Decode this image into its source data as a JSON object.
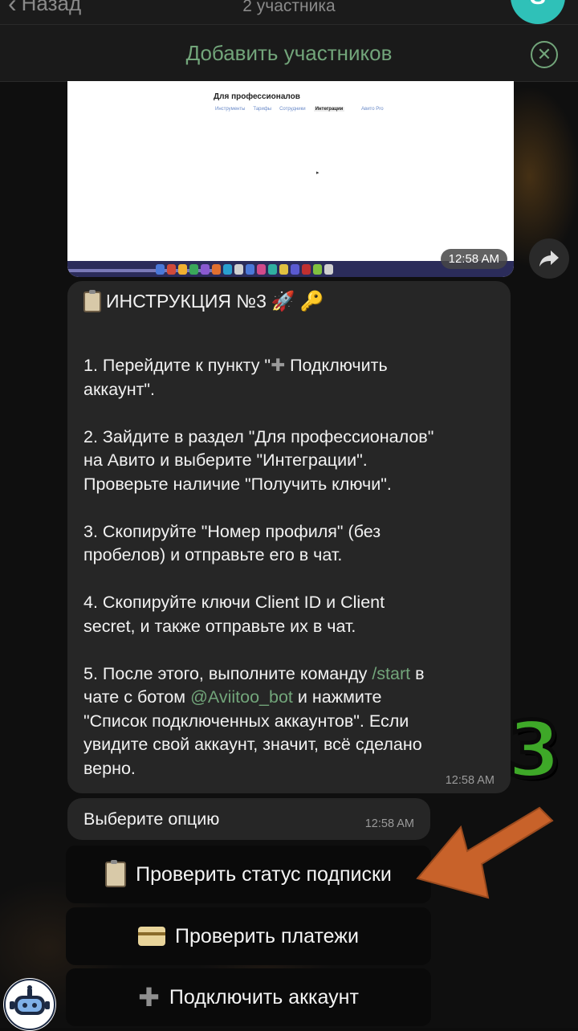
{
  "header": {
    "back_label": "Назад",
    "subtitle": "2 участника",
    "add_members": "Добавить участников"
  },
  "screenshot": {
    "page_title": "Для профессионалов",
    "tabs": [
      "Инструменты",
      "Тарифы",
      "Сотрудники",
      "Интеграции"
    ],
    "active_tab": "Интеграции",
    "link": "Авито Pro",
    "time": "12:58 AM"
  },
  "instruction": {
    "heading": "ИНСТРУКЦИЯ №3",
    "step1_a": "1. Перейдите к пункту \"",
    "step1_b": " Подключить",
    "step1_c": "аккаунт\".",
    "step2_a": "2. Зайдите в раздел \"Для профессионалов\"",
    "step2_b": "на Авито и выберите \"Интеграции\".",
    "step2_c": "Проверьте наличие \"Получить ключи\".",
    "step3_a": "3. Скопируйте \"Номер профиля\" (без",
    "step3_b": "пробелов) и отправьте его в чат.",
    "step4_a": "4. Скопируйте ключи Client ID и Client",
    "step4_b": "secret, и также отправьте их в чат.",
    "step5_a": "5. После этого, выполните команду ",
    "step5_cmd": "/start",
    "step5_b": " в",
    "step5_c": "чате с ботом ",
    "step5_bot": "@Aviitoo_bot",
    "step5_d": " и нажмите",
    "step5_e": "\"Список подключенных аккаунтов\". Если",
    "step5_f": "увидите свой аккаунт, значит, всё сделано",
    "step5_g": "верно.",
    "time": "12:58 AM"
  },
  "option_message": {
    "text": "Выберите опцию",
    "time": "12:58 AM"
  },
  "buttons": {
    "check_subscription": "Проверить статус подписки",
    "check_payments": "Проверить платежи",
    "connect_account": "Подключить аккаунт"
  },
  "annotation": {
    "step_number": "3"
  },
  "colors": {
    "accent_green": "#72a57a",
    "arrow_orange": "#c8622a",
    "badge_green": "#3ea828"
  }
}
